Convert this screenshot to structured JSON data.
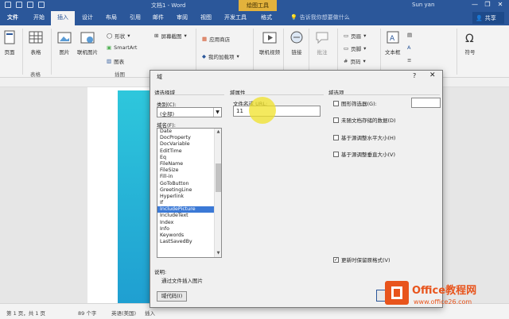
{
  "titlebar": {
    "doc_title": "文档1 - Word",
    "context_tab": "绘图工具",
    "user": "Sun yan",
    "minimize": "—",
    "restore": "❐",
    "close": "✕"
  },
  "tabs": {
    "file": "文件",
    "items": [
      "开始",
      "插入",
      "设计",
      "布局",
      "引用",
      "邮件",
      "审阅",
      "视图",
      "开发工具",
      "格式"
    ],
    "active": "插入",
    "tell_me": "告诉我你想要做什么",
    "share": "共享"
  },
  "ribbon": {
    "pages": "页面",
    "table": "表格",
    "table_group": "表格",
    "picture": "图片",
    "online_picture": "联机图片",
    "shapes": "形状",
    "smartart": "SmartArt",
    "chart": "图表",
    "screenshot": "屏幕截图",
    "illustrations_group": "插图",
    "store": "应用商店",
    "my_addins": "我的加载项",
    "online_video": "联机视频",
    "link": "链接",
    "comment": "批注",
    "header": "页眉",
    "footer": "页脚",
    "page_number": "页码",
    "textbox": "文本框",
    "symbol": "符号"
  },
  "dialog": {
    "title": "域",
    "help": "?",
    "close": "✕",
    "choose_field": "请选择域",
    "category_label": "类别(C):",
    "category_value": "(全部)",
    "field_names_label": "域名(F):",
    "field_names": [
      "Date",
      "DocProperty",
      "DocVariable",
      "EditTime",
      "Eq",
      "FileName",
      "FileSize",
      "Fill-in",
      "GoToButton",
      "GreetingLine",
      "Hyperlink",
      "If",
      "IncludePicture",
      "IncludeText",
      "Index",
      "Info",
      "Keywords",
      "LastSavedBy"
    ],
    "selected_field": "IncludePicture",
    "field_properties": "域属性",
    "url_label": "文件名或 URL:",
    "url_value": "11",
    "field_options": "域选项",
    "options": [
      {
        "label": "图形筛选器(G):",
        "checked": false
      },
      {
        "label": "未随文档存储的数据(D)",
        "checked": false
      },
      {
        "label": "基于源调整水平大小(H)",
        "checked": false
      },
      {
        "label": "基于源调整垂直大小(V)",
        "checked": false
      }
    ],
    "preserve_format": {
      "label": "更新时保留原格式(V)",
      "checked": true
    },
    "description_label": "说明:",
    "description": "通过文件插入图片",
    "field_codes_button": "域代码(I)"
  },
  "statusbar": {
    "page_info": "第 1 页，共 1 页",
    "words": "89 个字",
    "language": "英语(美国)",
    "insert_mode": "插入"
  },
  "watermark": {
    "brand": "Office教程网",
    "url": "www.office26.com"
  },
  "colors": {
    "word_blue": "#2b579a",
    "context_gold": "#e3b23c",
    "selection_blue": "#3b79d6",
    "cyan_shape": "#2ec7dc",
    "watermark_orange": "#e8541c"
  }
}
